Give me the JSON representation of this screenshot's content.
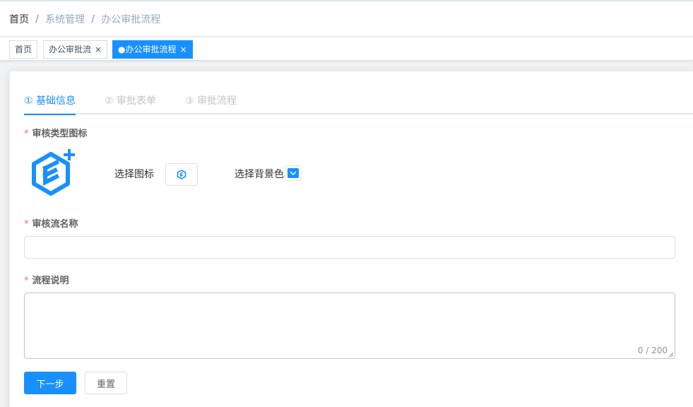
{
  "breadcrumb": {
    "items": [
      "首页",
      "系统管理",
      "办公审批流程"
    ],
    "separator": "/"
  },
  "tags": [
    {
      "label": "首页",
      "closable": false,
      "active": false
    },
    {
      "label": "办公审批流",
      "closable": true,
      "active": false
    },
    {
      "label": "●办公审批流程",
      "closable": true,
      "active": true
    }
  ],
  "tag_close_glyph": "×",
  "steps": [
    {
      "label": "① 基础信息",
      "active": true
    },
    {
      "label": "② 审批表单",
      "active": false
    },
    {
      "label": "③ 审批流程",
      "active": false
    }
  ],
  "form": {
    "required_mark": "*",
    "icon_section_label": "审核类型图标",
    "choose_icon_label": "选择图标",
    "choose_bg_label": "选择背景色",
    "name_label": "审核流名称",
    "name_value": "",
    "desc_label": "流程说明",
    "desc_counter": "0 / 200"
  },
  "buttons": {
    "next": "下一步",
    "reset": "重置"
  },
  "icons": {
    "large_icon": "hexagon-e-icon",
    "plus": "plus-icon",
    "small_icon": "hexagon-e-icon",
    "color_dropdown": "chevron-down-icon"
  },
  "colors": {
    "accent": "#1890ff",
    "required": "#f56c6c"
  }
}
